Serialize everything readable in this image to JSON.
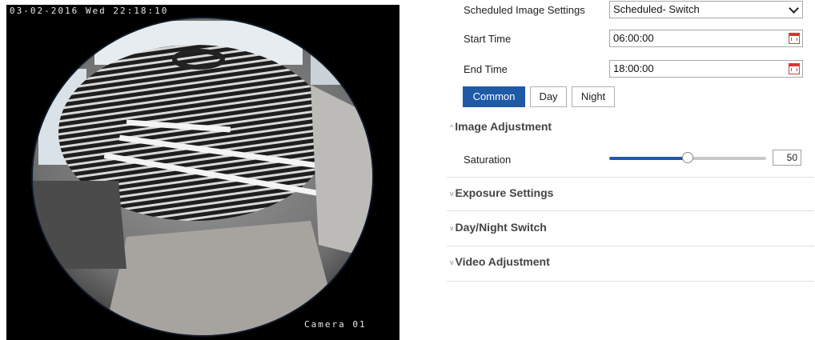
{
  "preview": {
    "timestamp": "03-02-2016 Wed 22:18:10",
    "camera_name": "Camera 01"
  },
  "settings": {
    "scheduled": {
      "label": "Scheduled Image Settings",
      "value": "Scheduled- Switch"
    },
    "start_time": {
      "label": "Start Time",
      "value": "06:00:00"
    },
    "end_time": {
      "label": "End Time",
      "value": "18:00:00"
    },
    "tabs": [
      {
        "label": "Common",
        "active": true
      },
      {
        "label": "Day",
        "active": false
      },
      {
        "label": "Night",
        "active": false
      }
    ],
    "sections": [
      {
        "title": "Image Adjustment",
        "expanded": true,
        "items": [
          {
            "label": "Saturation",
            "value": "50",
            "level": 0.5
          }
        ]
      },
      {
        "title": "Exposure Settings",
        "expanded": false
      },
      {
        "title": "Day/Night Switch",
        "expanded": false
      },
      {
        "title": "Video Adjustment",
        "expanded": false
      }
    ]
  },
  "colors": {
    "accent": "#1f5aa6",
    "preview_bg": "#000000"
  }
}
